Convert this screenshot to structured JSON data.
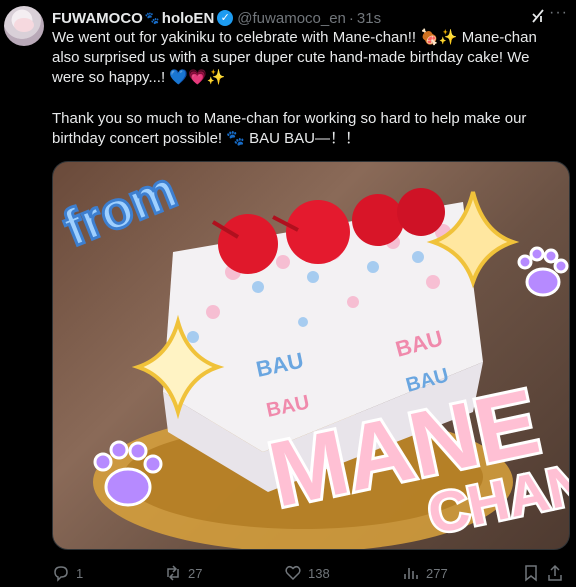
{
  "post": {
    "author_name": "FUWAMOCO",
    "author_org": "holoEN",
    "handle": "@fuwamoco_en",
    "separator": "·",
    "time": "31s",
    "verified_glyph": "✓",
    "paragraph1": "We went out for yakiniku to celebrate with Mane-chan!! 🍖✨ Mane-chan also surprised us with a super duper cute hand-made birthday cake! We were so happy...! 💙💗✨",
    "paragraph2": "Thank you so much to Mane-chan for working so hard to help make our birthday concert possible! 🐾 BAU BAU—！！"
  },
  "image": {
    "word_from": "from",
    "word_mane": "MANE",
    "word_chan": "CHAN",
    "cake_text": [
      "BAU",
      "BAU",
      "BAU",
      "BAU"
    ]
  },
  "actions": {
    "reply_count": "1",
    "repost_count": "27",
    "like_count": "138",
    "views_count": "277"
  },
  "icons": {
    "avatar": "avatar",
    "paw": "paw-icon",
    "verified": "verified-badge-icon",
    "grok": "grok-icon",
    "more": "more-icon",
    "reply": "reply-icon",
    "repost": "repost-icon",
    "like": "heart-icon",
    "views": "views-icon",
    "bookmark": "bookmark-icon",
    "share": "share-icon"
  },
  "colors": {
    "accent_blue": "#1d9bf0",
    "muted": "#71767b",
    "text": "#e7e9ea",
    "background": "#000000"
  }
}
